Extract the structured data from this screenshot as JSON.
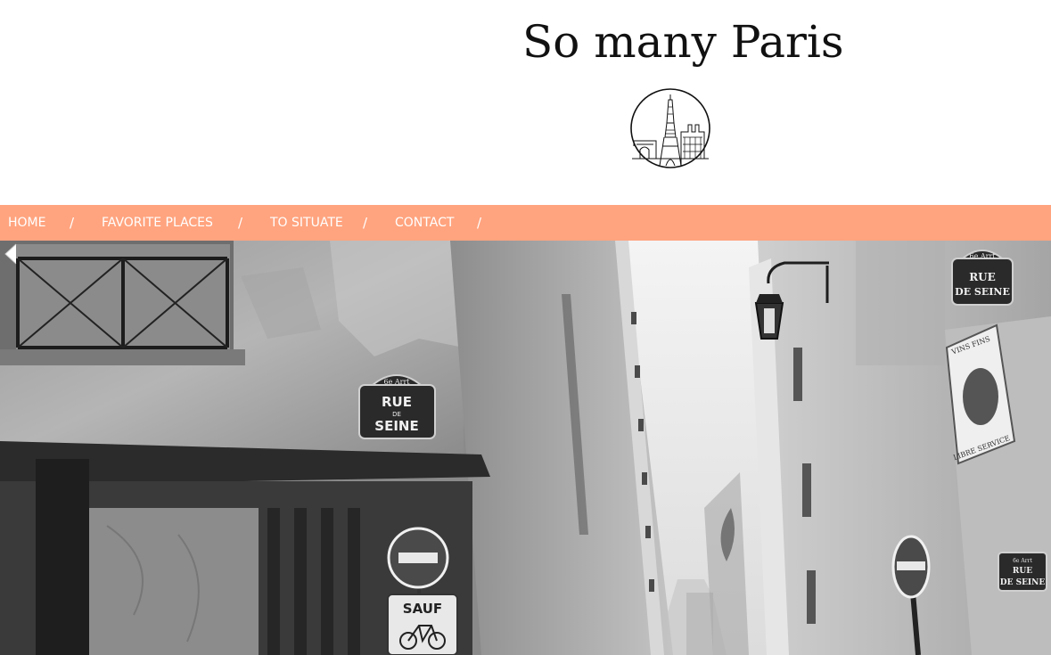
{
  "site": {
    "title": "So many Paris"
  },
  "nav": {
    "items": [
      {
        "label": "HOME"
      },
      {
        "label": "FAVORITE PLACES"
      },
      {
        "label": "TO SITUATE"
      },
      {
        "label": "CONTACT"
      }
    ],
    "separator": "/"
  },
  "hero": {
    "street_sign_left": {
      "arrondissement": "6e Arrt",
      "line1": "RUE",
      "line2": "DE",
      "line3": "SEINE"
    },
    "street_sign_right": {
      "arrondissement": "6e Arrt",
      "line1": "RUE",
      "line2": "DE SEINE"
    },
    "street_sign_small": {
      "arrondissement": "6e Arrt",
      "line1": "RUE",
      "line2": "DE SEINE"
    },
    "sauf_sign": "SAUF",
    "shop_sign": {
      "top": "VINS FINS",
      "bottom": "LIBRE SERVICE"
    }
  },
  "colors": {
    "nav_bg": "#ffa47f",
    "nav_text": "#ffffff",
    "title": "#111111"
  },
  "icons": {
    "logo": "paris-skyline-logo-icon",
    "prev": "chevron-left-icon"
  }
}
